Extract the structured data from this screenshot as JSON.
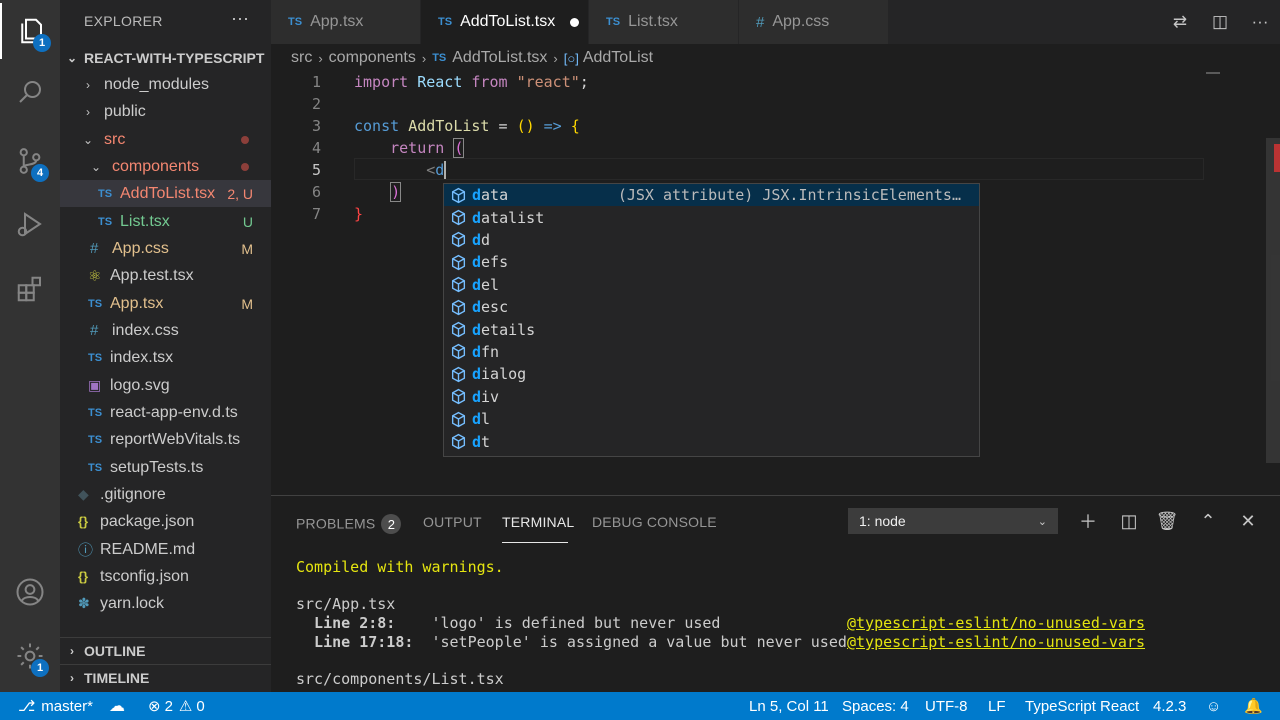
{
  "activity_bar": {
    "explorer_badge": "1",
    "scm_badge": "4",
    "settings_badge": "1"
  },
  "sidebar": {
    "title": "EXPLORER",
    "more": "···",
    "project": "REACT-WITH-TYPESCRIPT",
    "items": [
      {
        "label": "node_modules",
        "icon": "chevron-right",
        "deco": ""
      },
      {
        "label": "public",
        "icon": "chevron-right",
        "deco": ""
      },
      {
        "label": "src",
        "icon": "chevron-down",
        "deco": "dot"
      },
      {
        "label": "components",
        "icon": "chevron-down",
        "deco": "dot"
      },
      {
        "label": "AddToList.tsx",
        "icon": "TS",
        "deco": "2, U"
      },
      {
        "label": "List.tsx",
        "icon": "TS",
        "deco": "U"
      },
      {
        "label": "App.css",
        "icon": "#",
        "deco": "M"
      },
      {
        "label": "App.test.tsx",
        "icon": "react-icon",
        "deco": ""
      },
      {
        "label": "App.tsx",
        "icon": "TS",
        "deco": "M"
      },
      {
        "label": "index.css",
        "icon": "#",
        "deco": ""
      },
      {
        "label": "index.tsx",
        "icon": "TS",
        "deco": ""
      },
      {
        "label": "logo.svg",
        "icon": "image-icon",
        "deco": ""
      },
      {
        "label": "react-app-env.d.ts",
        "icon": "TS",
        "deco": ""
      },
      {
        "label": "reportWebVitals.ts",
        "icon": "TS",
        "deco": ""
      },
      {
        "label": "setupTests.ts",
        "icon": "TS",
        "deco": ""
      },
      {
        "label": ".gitignore",
        "icon": "git-icon",
        "deco": ""
      },
      {
        "label": "package.json",
        "icon": "{}",
        "deco": ""
      },
      {
        "label": "README.md",
        "icon": "info-icon",
        "deco": ""
      },
      {
        "label": "tsconfig.json",
        "icon": "{}",
        "deco": ""
      },
      {
        "label": "yarn.lock",
        "icon": "yarn-icon",
        "deco": ""
      }
    ],
    "outline": "OUTLINE",
    "timeline": "TIMELINE"
  },
  "tabs": [
    {
      "label": "App.tsx",
      "icon": "TS",
      "active": false
    },
    {
      "label": "AddToList.tsx",
      "icon": "TS",
      "active": true,
      "dirty": true
    },
    {
      "label": "List.tsx",
      "icon": "TS",
      "active": false
    },
    {
      "label": "App.css",
      "icon": "#",
      "active": false
    }
  ],
  "breadcrumb": {
    "parts": [
      "src",
      "components",
      "AddToList.tsx",
      "AddToList"
    ]
  },
  "editor": {
    "line_numbers": [
      "1",
      "2",
      "3",
      "4",
      "5",
      "6",
      "7"
    ]
  },
  "suggest": {
    "detail": "(JSX attribute) JSX.IntrinsicElements…",
    "items": [
      {
        "match": "d",
        "rest": "ata"
      },
      {
        "match": "d",
        "rest": "atalist"
      },
      {
        "match": "d",
        "rest": "d"
      },
      {
        "match": "d",
        "rest": "efs"
      },
      {
        "match": "d",
        "rest": "el"
      },
      {
        "match": "d",
        "rest": "esc"
      },
      {
        "match": "d",
        "rest": "etails"
      },
      {
        "match": "d",
        "rest": "fn"
      },
      {
        "match": "d",
        "rest": "ialog"
      },
      {
        "match": "d",
        "rest": "iv"
      },
      {
        "match": "d",
        "rest": "l"
      },
      {
        "match": "d",
        "rest": "t"
      }
    ]
  },
  "panel": {
    "tabs": {
      "problems": "PROBLEMS",
      "problems_count": "2",
      "output": "OUTPUT",
      "terminal": "TERMINAL",
      "debug": "DEBUG CONSOLE"
    },
    "terminal_select": "1: node",
    "terminal_lines": {
      "compiled": "Compiled with warnings.",
      "file1": "src/App.tsx",
      "w1_loc": "  Line 2:8:",
      "w1_msg": "    'logo' is defined but never used",
      "w1_rule": "@typescript-eslint/no-unused-vars",
      "w2_loc": "  Line 17:18:",
      "w2_msg": "  'setPeople' is assigned a value but never used",
      "w2_rule": "@typescript-eslint/no-unused-vars",
      "file2": "src/components/List.tsx"
    }
  },
  "statusbar": {
    "branch": "master*",
    "errors": "2",
    "warnings": "0",
    "position": "Ln 5, Col 11",
    "spaces": "Spaces: 4",
    "encoding": "UTF-8",
    "eol": "LF",
    "language": "TypeScript React",
    "version": "4.2.3"
  }
}
